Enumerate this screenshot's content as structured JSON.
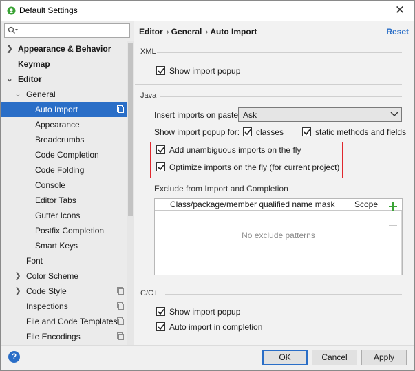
{
  "window": {
    "title": "Default Settings"
  },
  "sidebar": {
    "search_placeholder": "",
    "items": [
      {
        "label": "Appearance & Behavior"
      },
      {
        "label": "Keymap"
      },
      {
        "label": "Editor"
      },
      {
        "label": "General"
      },
      {
        "label": "Auto Import"
      },
      {
        "label": "Appearance"
      },
      {
        "label": "Breadcrumbs"
      },
      {
        "label": "Code Completion"
      },
      {
        "label": "Code Folding"
      },
      {
        "label": "Console"
      },
      {
        "label": "Editor Tabs"
      },
      {
        "label": "Gutter Icons"
      },
      {
        "label": "Postfix Completion"
      },
      {
        "label": "Smart Keys"
      },
      {
        "label": "Font"
      },
      {
        "label": "Color Scheme"
      },
      {
        "label": "Code Style"
      },
      {
        "label": "Inspections"
      },
      {
        "label": "File and Code Templates"
      },
      {
        "label": "File Encodings"
      }
    ]
  },
  "header": {
    "breadcrumb": [
      "Editor",
      "General",
      "Auto Import"
    ],
    "separator": "›",
    "reset_label": "Reset"
  },
  "xml": {
    "section_label": "XML",
    "show_import_popup": {
      "label": "Show import popup",
      "checked": true
    }
  },
  "java": {
    "section_label": "Java",
    "insert_imports_label": "Insert imports on paste:",
    "insert_imports_value": "Ask",
    "show_popup_for_label": "Show import popup for:",
    "classes": {
      "label": "classes",
      "checked": true
    },
    "static_methods": {
      "label": "static methods and fields",
      "checked": true
    },
    "add_unambiguous": {
      "label": "Add unambiguous imports on the fly",
      "checked": true
    },
    "optimize_imports": {
      "label": "Optimize imports on the fly (for current project)",
      "checked": true
    },
    "exclude_label": "Exclude from Import and Completion",
    "table": {
      "columns": [
        "Class/package/member qualified name mask",
        "Scope"
      ],
      "empty_text": "No exclude patterns"
    }
  },
  "cpp": {
    "section_label": "C/C++",
    "show_import_popup": {
      "label": "Show import popup",
      "checked": true
    },
    "auto_import": {
      "label": "Auto import in completion",
      "checked": true
    }
  },
  "footer": {
    "help_label": "?",
    "ok_label": "OK",
    "cancel_label": "Cancel",
    "apply_label": "Apply"
  },
  "colors": {
    "accent": "#2a6ec7",
    "highlight_border": "#e0282e",
    "add_icon": "#3aa335"
  }
}
